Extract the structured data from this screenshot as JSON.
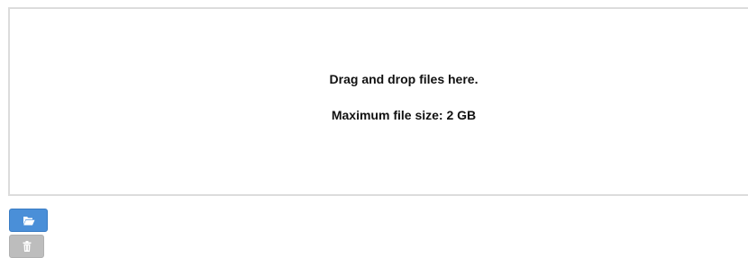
{
  "dropzone": {
    "message": "Drag and drop files here.",
    "max_size": "Maximum file size: 2 GB"
  },
  "toolbar": {
    "browse_icon": "folder-open-icon",
    "clear_icon": "trash-icon",
    "browse_color": "#4a8fd8",
    "clear_color": "#bdbdbd"
  }
}
